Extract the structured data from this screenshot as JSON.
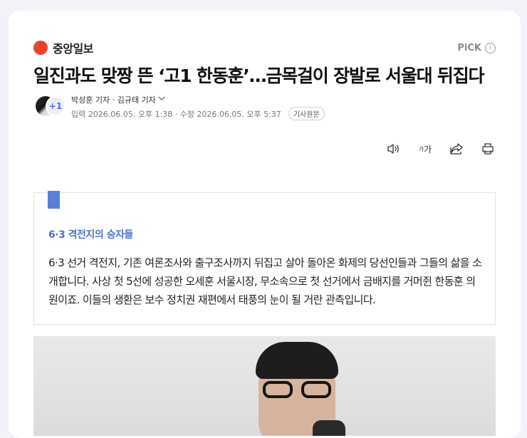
{
  "publisher": {
    "logo_text": "중앙일보",
    "name": "중앙일보",
    "pick_label": "PiCK",
    "info_glyph": "i"
  },
  "headline": "일진과도 맞짱 뜬 ‘고1 한동훈’…금목걸이 장발로 서울대 뒤집다",
  "byline": {
    "extra_count": "+1",
    "reporters": "박성훈 기자 · 김규태 기자",
    "input_label": "입력 2026.06.05. 오후 1:38",
    "separator": "·",
    "edited_label": "수정 2026.06.05. 오후 5:37",
    "original_button": "기사원문"
  },
  "toolbar": {
    "font_size_small": "가",
    "font_size_large": "가"
  },
  "summary": {
    "title": "6·3 격전지의 승자들",
    "body": "6·3 선거 격전지, 기존 여론조사와 출구조사까지 뒤집고 살아 돌아온 화제의 당선인들과 그들의 삶을 소개합니다. 사상 첫 5선에 성공한 오세훈 서울시장, 무소속으로 첫 선거에서 금배지를 거머쥔 한동훈 의원이죠. 이들의 생환은 보수 정치권 재편에서 태풍의 눈이 될 거란 관측입니다."
  },
  "colors": {
    "accent": "#4e74c8",
    "logo": "#e8442b",
    "marker": "#5b7fd8"
  }
}
